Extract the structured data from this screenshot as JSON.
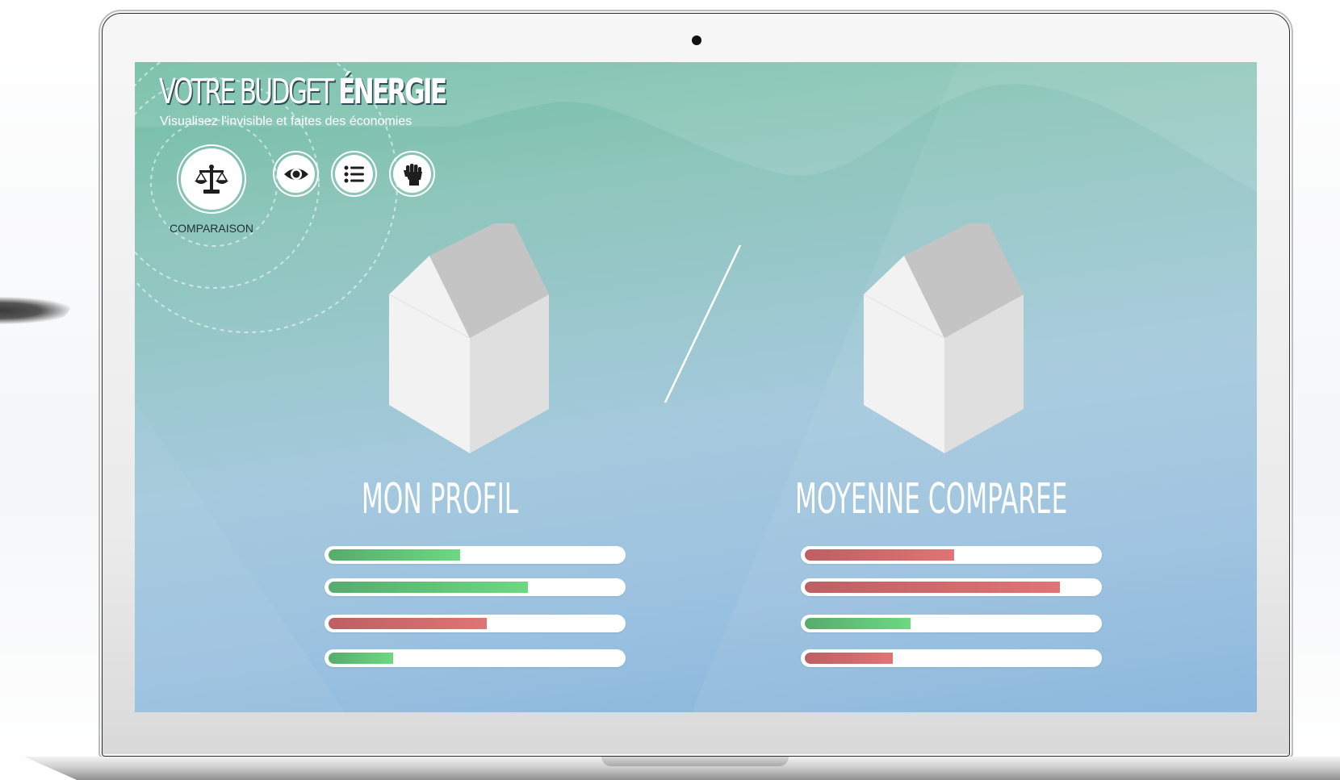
{
  "colors": {
    "bar_green": "#6dd882",
    "bar_red": "#e07474",
    "screen_top": "#6fbda2",
    "screen_bottom": "#86b4da"
  },
  "app": {
    "title_light": "VOTRE BUDGET ",
    "title_bold": "ÉNERGIE",
    "subtitle": "Visualisez l'invisible et faites des économies"
  },
  "nav": {
    "items": [
      {
        "icon": "scales-icon",
        "label": "COMPARAISON",
        "active": true
      },
      {
        "icon": "eye-icon",
        "label": "",
        "active": false
      },
      {
        "icon": "list-icon",
        "label": "",
        "active": false
      },
      {
        "icon": "fist-icon",
        "label": "",
        "active": false
      }
    ]
  },
  "profiles": [
    {
      "title": "MON PROFIL",
      "bars": [
        {
          "fill": 0.45,
          "status": "good"
        },
        {
          "fill": 0.68,
          "status": "good"
        },
        {
          "fill": 0.54,
          "status": "bad"
        },
        {
          "fill": 0.22,
          "status": "good"
        }
      ]
    },
    {
      "title": "MOYENNE COMPAREE",
      "bars": [
        {
          "fill": 0.51,
          "status": "bad"
        },
        {
          "fill": 0.87,
          "status": "bad"
        },
        {
          "fill": 0.36,
          "status": "good"
        },
        {
          "fill": 0.3,
          "status": "bad"
        }
      ]
    }
  ]
}
